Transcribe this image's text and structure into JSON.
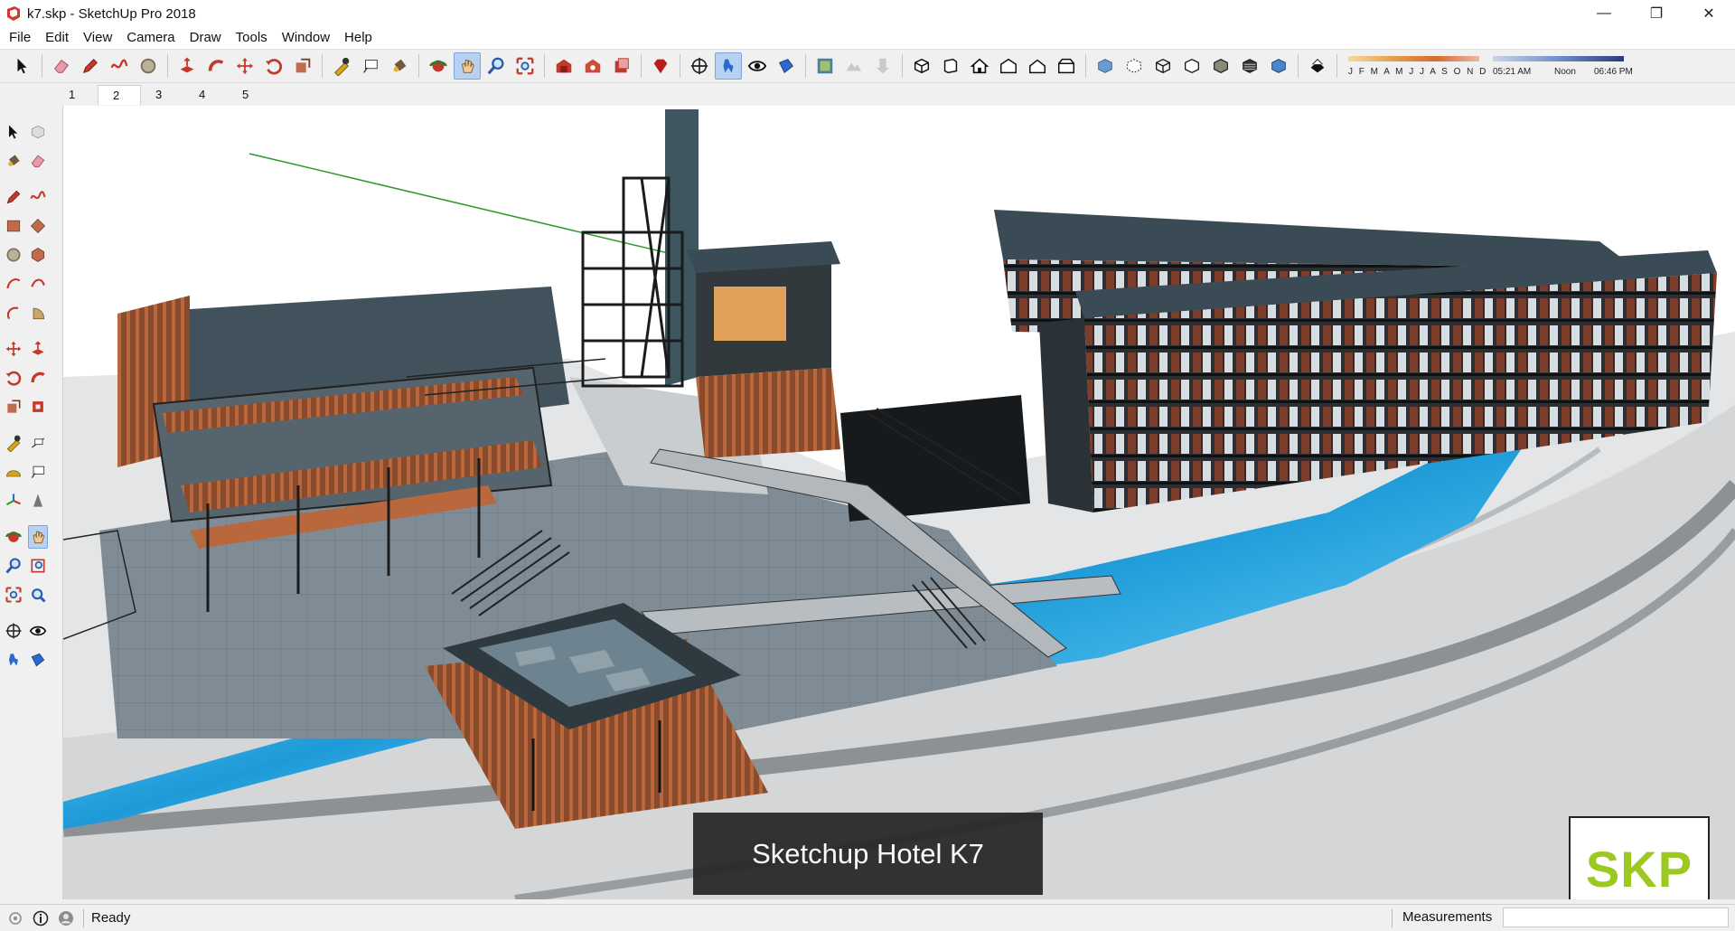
{
  "window": {
    "title": "k7.skp - SketchUp Pro 2018",
    "minimize_glyph": "—",
    "maximize_glyph": "❐",
    "close_glyph": "✕"
  },
  "menu": [
    "File",
    "Edit",
    "View",
    "Camera",
    "Draw",
    "Tools",
    "Window",
    "Help"
  ],
  "toolbar": {
    "groups": [
      [
        "select-icon"
      ],
      [
        "eraser-icon",
        "pencil-icon",
        "freehand-icon",
        "circle-icon"
      ],
      [
        "push-pull-icon",
        "follow-me-icon",
        "move-icon",
        "rotate-icon",
        "scale-icon"
      ],
      [
        "tape-measure-icon",
        "text-icon",
        "paint-bucket-icon"
      ],
      [
        "orbit-icon",
        "pan-icon",
        "zoom-icon",
        "zoom-extents-icon"
      ],
      [
        "warehouse-icon",
        "extension-warehouse-icon",
        "layout-icon"
      ],
      [
        "ruby-icon"
      ],
      [
        "position-camera-icon",
        "walk-icon",
        "look-around-icon",
        "section-plane-icon"
      ],
      [
        "add-location-icon",
        "toggle-terrain-icon",
        "photo-texture-icon"
      ],
      [
        "iso-view-icon",
        "front-view-icon",
        "top-view-icon",
        "right-view-icon",
        "back-view-icon",
        "left-view-icon"
      ],
      [
        "xray-icon",
        "back-edges-icon",
        "wireframe-icon",
        "hidden-line-icon",
        "shaded-icon",
        "shaded-texture-icon",
        "monochrome-icon"
      ],
      [
        "shadows-icon"
      ]
    ],
    "active": [
      "pan-icon",
      "walk-icon"
    ],
    "shadow_settings": {
      "months": "J F M A M J J A S O N D",
      "time_start": "05:21 AM",
      "time_mid": "Noon",
      "time_end": "06:46 PM",
      "month_gradient": [
        "#f5d9a0",
        "#e7a04a",
        "#d96a2c",
        "#e8b7a7"
      ],
      "time_gradient": [
        "#c9d4e8",
        "#6f8fc8",
        "#283a7a"
      ]
    }
  },
  "scenes": {
    "tabs": [
      "1",
      "2",
      "3",
      "4",
      "5"
    ],
    "active": "2"
  },
  "left_toolbar": {
    "rows": [
      [
        "select-icon",
        "component-icon"
      ],
      [
        "paint-bucket-icon",
        "eraser-icon"
      ],
      [
        "gap"
      ],
      [
        "line-icon",
        "freehand-icon"
      ],
      [
        "rectangle-icon",
        "rotated-rectangle-icon"
      ],
      [
        "circle-icon",
        "polygon-icon"
      ],
      [
        "arc-icon",
        "two-point-arc-icon"
      ],
      [
        "three-point-arc-icon",
        "pie-icon"
      ],
      [
        "gap"
      ],
      [
        "move-icon",
        "push-pull-icon"
      ],
      [
        "rotate-icon",
        "follow-me-icon"
      ],
      [
        "scale-icon",
        "offset-icon"
      ],
      [
        "gap"
      ],
      [
        "tape-measure-icon",
        "dimension-icon"
      ],
      [
        "protractor-icon",
        "text-icon"
      ],
      [
        "axes-icon",
        "3d-text-icon"
      ],
      [
        "gap"
      ],
      [
        "orbit-icon",
        "pan-icon"
      ],
      [
        "zoom-icon",
        "zoom-window-icon"
      ],
      [
        "zoom-extents-icon",
        "previous-view-icon"
      ],
      [
        "gap"
      ],
      [
        "position-camera-icon",
        "look-around-icon"
      ],
      [
        "walk-icon",
        "section-plane-icon"
      ]
    ],
    "active": "pan-icon"
  },
  "viewport": {
    "caption": "Sketchup Hotel K7",
    "logo": "SKP",
    "colors": {
      "water": "#2ea8e4",
      "roof": "#3b4b55",
      "wood": "#a3532f",
      "ground": "#d8d8d8",
      "axis_green": "#2e9a2e"
    }
  },
  "status": {
    "text": "Ready",
    "measurements_label": "Measurements",
    "measurements_value": ""
  }
}
